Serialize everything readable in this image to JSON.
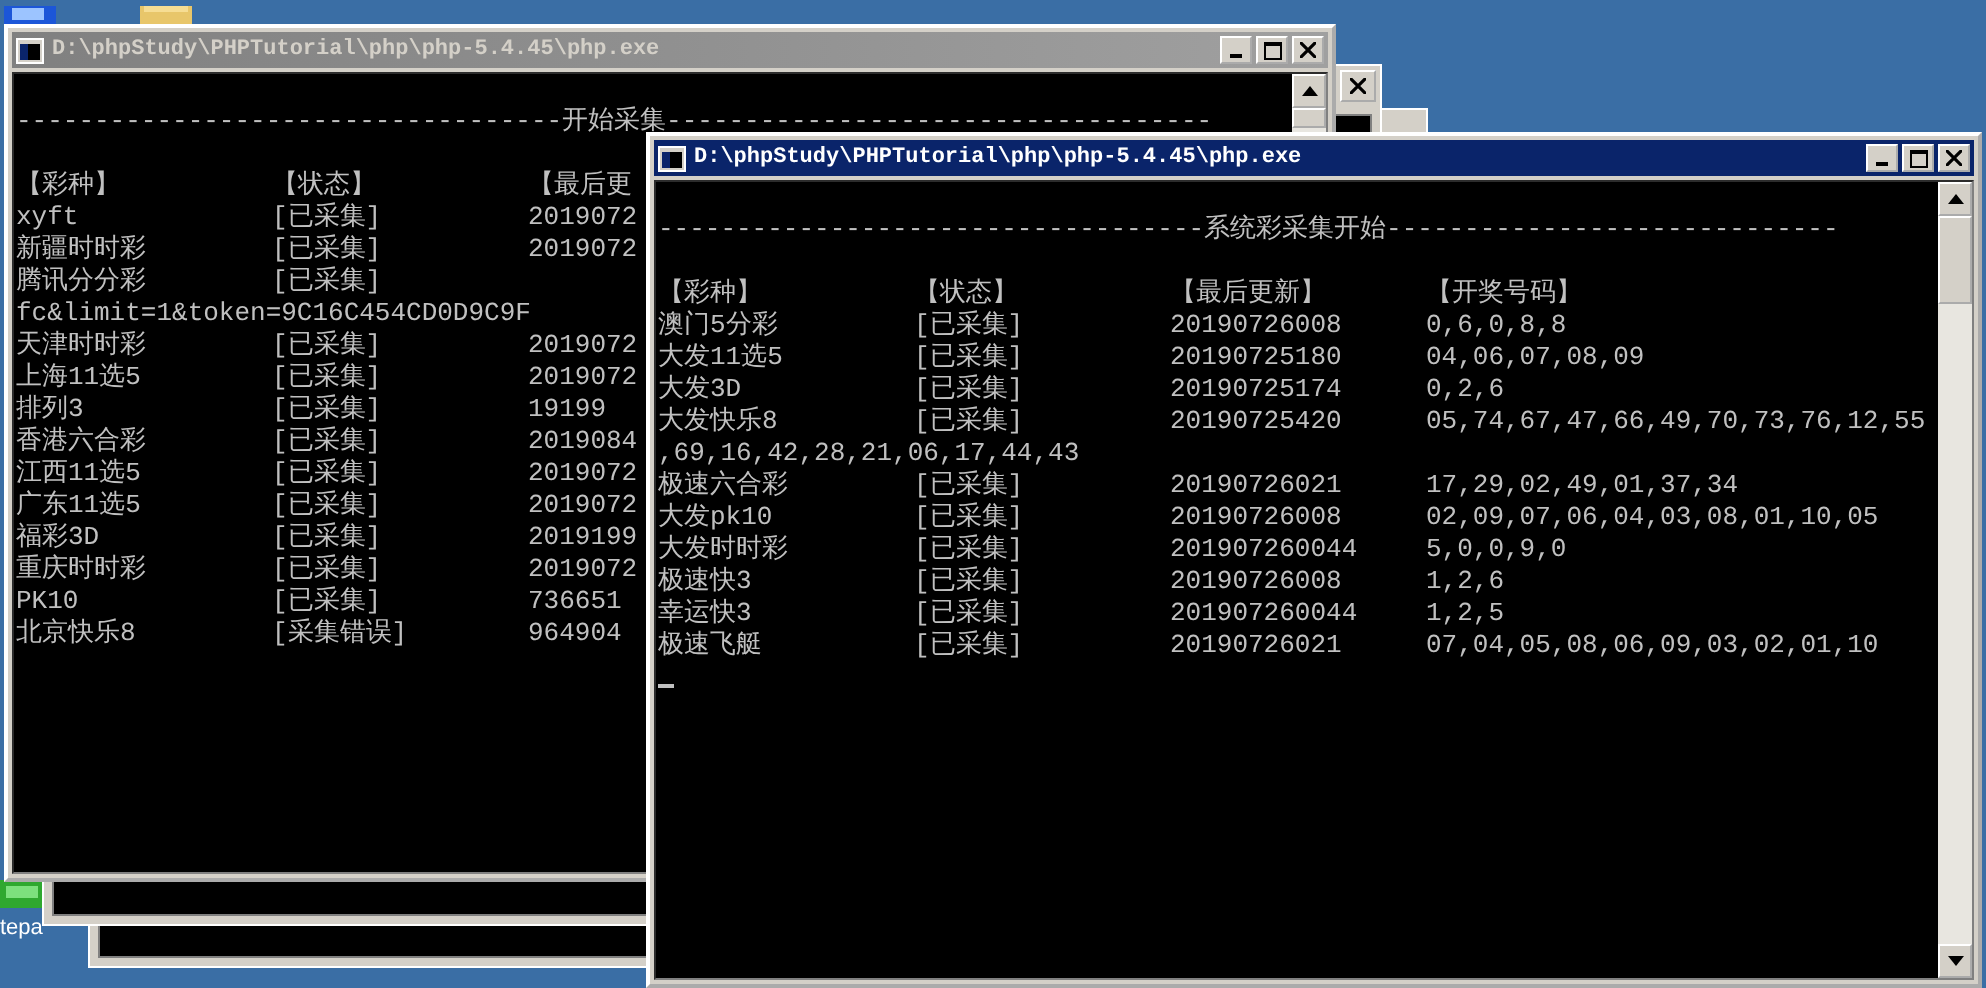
{
  "desktop": {
    "icon_label": "tepa"
  },
  "windows": [
    {
      "active": false
    },
    {
      "active": false
    },
    {
      "active": false,
      "title": "D:\\phpStudy\\PHPTutorial\\php\\php-5.4.45\\php.exe",
      "lines": [
        {
          "kind": "blank"
        },
        {
          "kind": "raw",
          "text": "-----------------------------------开始采集-----------------------------------"
        },
        {
          "kind": "blank"
        },
        {
          "kind": "row",
          "cells": [
            "【彩种】",
            "【状态】",
            "【最后更"
          ]
        },
        {
          "kind": "row",
          "cells": [
            "xyft",
            "[已采集]",
            "2019072"
          ]
        },
        {
          "kind": "row",
          "cells": [
            "新疆时时彩",
            "[已采集]",
            "2019072"
          ]
        },
        {
          "kind": "row",
          "cells": [
            "腾讯分分彩",
            "[已采集]"
          ]
        },
        {
          "kind": "raw",
          "text": "fc&limit=1&token=9C16C454CD0D9C9F"
        },
        {
          "kind": "row",
          "cells": [
            "天津时时彩",
            "[已采集]",
            "2019072"
          ]
        },
        {
          "kind": "row",
          "cells": [
            "上海11选5",
            "[已采集]",
            "2019072"
          ]
        },
        {
          "kind": "row",
          "cells": [
            "排列3",
            "[已采集]",
            "19199"
          ]
        },
        {
          "kind": "row",
          "cells": [
            "香港六合彩",
            "[已采集]",
            "2019084"
          ]
        },
        {
          "kind": "row",
          "cells": [
            "江西11选5",
            "[已采集]",
            "2019072"
          ]
        },
        {
          "kind": "row",
          "cells": [
            "广东11选5",
            "[已采集]",
            "2019072"
          ]
        },
        {
          "kind": "row",
          "cells": [
            "福彩3D",
            "[已采集]",
            "2019199"
          ]
        },
        {
          "kind": "row",
          "cells": [
            "重庆时时彩",
            "[已采集]",
            "2019072"
          ]
        },
        {
          "kind": "row",
          "cells": [
            "PK10",
            "[已采集]",
            "736651"
          ]
        },
        {
          "kind": "row",
          "cells": [
            "北京快乐8",
            "[采集错误]",
            "964904"
          ]
        }
      ]
    },
    {
      "active": true,
      "title": "D:\\phpStudy\\PHPTutorial\\php\\php-5.4.45\\php.exe",
      "lines": [
        {
          "kind": "blank"
        },
        {
          "kind": "raw",
          "text": "-----------------------------------系统彩采集开始-----------------------------"
        },
        {
          "kind": "blank"
        },
        {
          "kind": "row",
          "cells": [
            "【彩种】",
            "【状态】",
            "【最后更新】",
            "【开奖号码】"
          ]
        },
        {
          "kind": "row",
          "cells": [
            "澳门5分彩",
            "[已采集]",
            "20190726008",
            "0,6,0,8,8"
          ]
        },
        {
          "kind": "row",
          "cells": [
            "大发11选5",
            "[已采集]",
            "20190725180",
            "04,06,07,08,09"
          ]
        },
        {
          "kind": "row",
          "cells": [
            "大发3D",
            "[已采集]",
            "20190725174",
            "0,2,6"
          ]
        },
        {
          "kind": "row",
          "cells": [
            "大发快乐8",
            "[已采集]",
            "20190725420",
            "05,74,67,47,66,49,70,73,76,12,55"
          ]
        },
        {
          "kind": "raw",
          "text": ",69,16,42,28,21,06,17,44,43"
        },
        {
          "kind": "row",
          "cells": [
            "极速六合彩",
            "[已采集]",
            "20190726021",
            "17,29,02,49,01,37,34"
          ]
        },
        {
          "kind": "row",
          "cells": [
            "大发pk10",
            "[已采集]",
            "20190726008",
            "02,09,07,06,04,03,08,01,10,05"
          ]
        },
        {
          "kind": "row",
          "cells": [
            "大发时时彩",
            "[已采集]",
            "201907260044",
            "5,0,0,9,0"
          ]
        },
        {
          "kind": "row",
          "cells": [
            "极速快3",
            "[已采集]",
            "20190726008",
            "1,2,6"
          ]
        },
        {
          "kind": "row",
          "cells": [
            "幸运快3",
            "[已采集]",
            "201907260044",
            "1,2,5"
          ]
        },
        {
          "kind": "row",
          "cells": [
            "极速飞艇",
            "[已采集]",
            "20190726021",
            "07,04,05,08,06,09,03,02,01,10"
          ]
        },
        {
          "kind": "cursor"
        }
      ]
    }
  ]
}
